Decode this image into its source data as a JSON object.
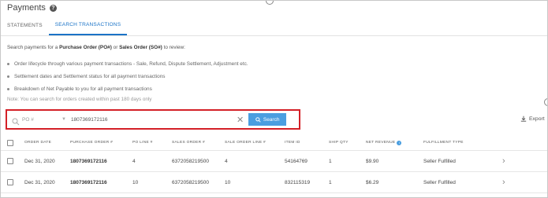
{
  "header": {
    "title": "Payments"
  },
  "tabs": [
    {
      "label": "STATEMENTS",
      "active": false
    },
    {
      "label": "SEARCH TRANSACTIONS",
      "active": true
    }
  ],
  "info": {
    "prefix": "Search payments for a ",
    "po": "Purchase Order (PO#)",
    "or": " or ",
    "so": "Sales Order (SO#)",
    "suffix": " to review:"
  },
  "bullets": [
    "Order lifecycle through various payment transactions - Sale, Refund, Dispute Settlement, Adjustment etc.",
    "Settlement dates and Settlement status for all payment transactions",
    "Breakdown of Net Payable to you for all payment transactions"
  ],
  "note": "Note: You can search for orders created within past 180 days only",
  "search": {
    "type_selected": "PO #",
    "value": "1807369172116",
    "button_label": "Search"
  },
  "export_label": "Export",
  "table": {
    "headers": [
      "ORDER DATE",
      "PURCHASE ORDER #",
      "PO LINE #",
      "SALES ORDER #",
      "SALE ORDER LINE #",
      "ITEM ID",
      "SHIP QTY",
      "NET REVENUE",
      "FULFILLMENT TYPE"
    ],
    "rows": [
      [
        "Dec 31, 2020",
        "1807369172116",
        "4",
        "6372058219500",
        "4",
        "54164769",
        "1",
        "$9.90",
        "Seller Fulfilled"
      ],
      [
        "Dec 31, 2020",
        "1807369172116",
        "10",
        "6372058219500",
        "10",
        "832115319",
        "1",
        "$6.29",
        "Seller Fulfilled"
      ]
    ]
  },
  "colors": {
    "accent": "#1a73c7",
    "button": "#4a9ee0",
    "highlight": "#d42027"
  }
}
